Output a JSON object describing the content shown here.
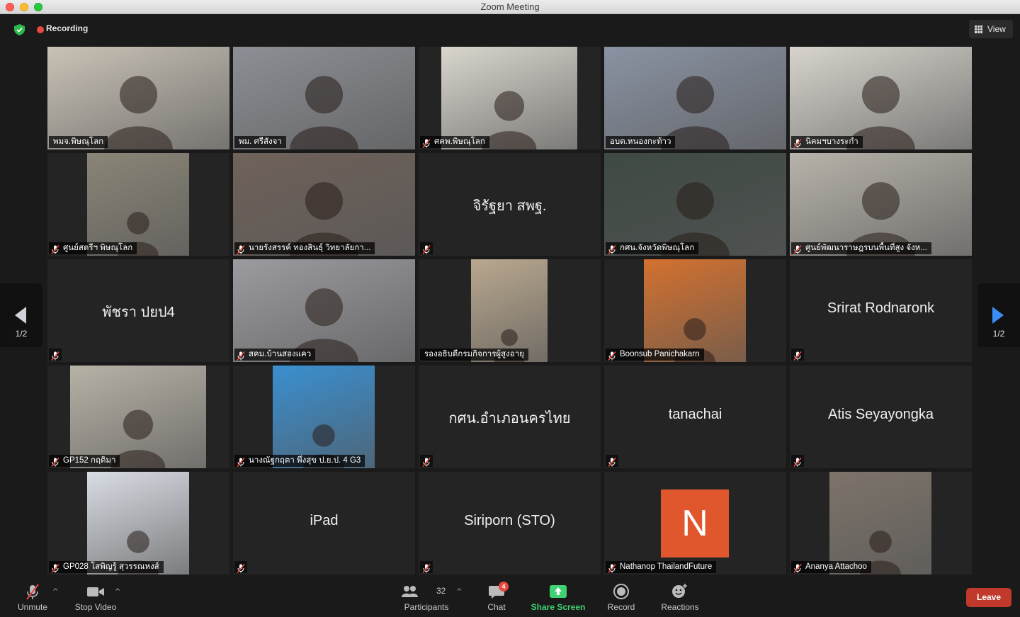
{
  "window": {
    "title": "Zoom Meeting"
  },
  "topbar": {
    "recording_label": "Recording",
    "view_label": "View"
  },
  "nav": {
    "page_left": "1/2",
    "page_right": "1/2"
  },
  "participants": [
    {
      "name": "พมจ.พิษณุโลก",
      "video": true,
      "muted": false,
      "bg": "#c9c2b6"
    },
    {
      "name": "พม. ศรีสังจา",
      "video": true,
      "muted": false,
      "bg": "#8c8f95"
    },
    {
      "name": "ศคพ.พิษณุโลก",
      "video": true,
      "muted": true,
      "bg": "#d9d6cd"
    },
    {
      "name": "อบต.หนองกะท้าว",
      "video": true,
      "muted": false,
      "active": true,
      "bg": "#8a93a3"
    },
    {
      "name": "นิคมฯบางระกำ",
      "video": true,
      "muted": true,
      "bg": "#d7d4cc"
    },
    {
      "name": "ศูนย์สตรีฯ พิษณุโลก",
      "video": true,
      "muted": true,
      "bg": "#8a8577"
    },
    {
      "name": "นายรังสรรค์ ทองสินธุ์ วิทยาลัยกา...",
      "video": true,
      "muted": true,
      "bg": "#6f625a"
    },
    {
      "display": "จิรัฐยา สพฐ.",
      "video": false,
      "muted": true
    },
    {
      "name": "กศน.จังหวัดพิษณุโลก",
      "video": true,
      "muted": true,
      "bg": "#3f4a44"
    },
    {
      "name": "ศูนย์พัฒนาราษฎรบนพื้นที่สูง จังห...",
      "video": true,
      "muted": true,
      "bg": "#b7b3aa"
    },
    {
      "display": "พัชรา ปยป4",
      "video": false,
      "muted": true
    },
    {
      "name": "สคม.บ้านสองแคว",
      "video": true,
      "muted": true,
      "bg": "#9b9ba0"
    },
    {
      "name": "รองอธิบดีกรมกิจการผู้สูงอายุ",
      "video": true,
      "muted": false,
      "bg": "#b9a88f"
    },
    {
      "name": "Boonsub Panichakarn",
      "video": true,
      "muted": true,
      "bg": "#d4712f"
    },
    {
      "display": "Srirat Rodnaronk",
      "video": false,
      "muted": true
    },
    {
      "name": "GP152 กฤติมา",
      "video": true,
      "muted": true,
      "bg": "#b7b2a6"
    },
    {
      "name": "นางณัฐกฤตา พึ่งสุข ป.ย.ป. 4 G3",
      "video": true,
      "muted": true,
      "bg": "#3a8fd0"
    },
    {
      "display": "กศน.อำเภอนครไทย",
      "video": false,
      "muted": true
    },
    {
      "display": "tanachai",
      "video": false,
      "muted": true
    },
    {
      "display": "Atis Seyayongka",
      "video": false,
      "muted": true
    },
    {
      "name": "GP028 โสพิญรู้ สุวรรณหงส์",
      "video": true,
      "muted": true,
      "bg": "#d9dde4"
    },
    {
      "display": "iPad",
      "video": false,
      "muted": true
    },
    {
      "display": "Siriporn (STO)",
      "video": false,
      "muted": true
    },
    {
      "name": "Nathanop ThailandFuture",
      "video": false,
      "avatar_letter": "N",
      "muted": true
    },
    {
      "name": "Ananya Attachoo",
      "video": true,
      "muted": true,
      "bg": "#7d746a"
    }
  ],
  "toolbar": {
    "unmute": "Unmute",
    "stop_video": "Stop Video",
    "participants_label": "Participants",
    "participants_count": "32",
    "chat": "Chat",
    "chat_badge": "4",
    "share_screen": "Share Screen",
    "record": "Record",
    "reactions": "Reactions",
    "leave": "Leave"
  },
  "colors": {
    "accent_green": "#3fd173",
    "leave_red": "#c0392b",
    "active_outline": "#e3e35a",
    "avatar_orange": "#e0572e"
  }
}
